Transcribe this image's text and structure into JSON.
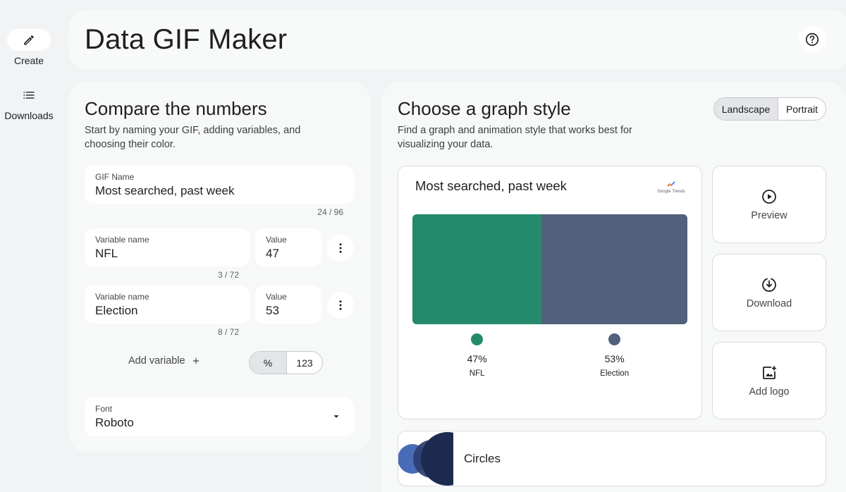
{
  "rail": {
    "create_label": "Create",
    "downloads_label": "Downloads",
    "create_icon": "pencil-icon",
    "downloads_icon": "list-icon"
  },
  "header": {
    "title": "Data GIF Maker",
    "help_icon": "help-circle-icon"
  },
  "compare": {
    "title": "Compare the numbers",
    "description": "Start by naming your GIF, adding variables, and choosing their color.",
    "gif_name": {
      "label": "GIF Name",
      "value": "Most searched, past week",
      "counter": "24 / 96"
    },
    "variables": [
      {
        "name_label": "Variable name",
        "name": "NFL",
        "value_label": "Value",
        "value": "47",
        "counter": "3 / 72"
      },
      {
        "name_label": "Variable name",
        "name": "Election",
        "value_label": "Value",
        "value": "53",
        "counter": "8 / 72"
      }
    ],
    "add_variable_label": "Add variable",
    "format_options": [
      "%",
      "123"
    ],
    "format_selected": "%",
    "font": {
      "label": "Font",
      "value": "Roboto"
    }
  },
  "graph": {
    "title": "Choose a graph style",
    "description": "Find a graph and animation style that works best for visualizing your data.",
    "orientation_options": [
      "Landscape",
      "Portrait"
    ],
    "orientation_selected": "Landscape",
    "preview": {
      "title": "Most searched, past week",
      "logo_text": "Google Trends",
      "items": [
        {
          "name": "NFL",
          "percent_label": "47%",
          "share": 47,
          "color": "#248a6b"
        },
        {
          "name": "Election",
          "percent_label": "53%",
          "share": 53,
          "color": "#51617c"
        }
      ]
    },
    "actions": [
      {
        "label": "Preview",
        "icon": "play-circle-icon"
      },
      {
        "label": "Download",
        "icon": "download-circle-icon"
      },
      {
        "label": "Add logo",
        "icon": "add-image-icon"
      }
    ],
    "styles": [
      {
        "label": "Circles"
      }
    ]
  },
  "colors": {
    "accent_green": "#248a6b",
    "accent_slate": "#51617c",
    "circle_blue": "#4a6bb8",
    "circle_navy": "#1d2a4f"
  }
}
